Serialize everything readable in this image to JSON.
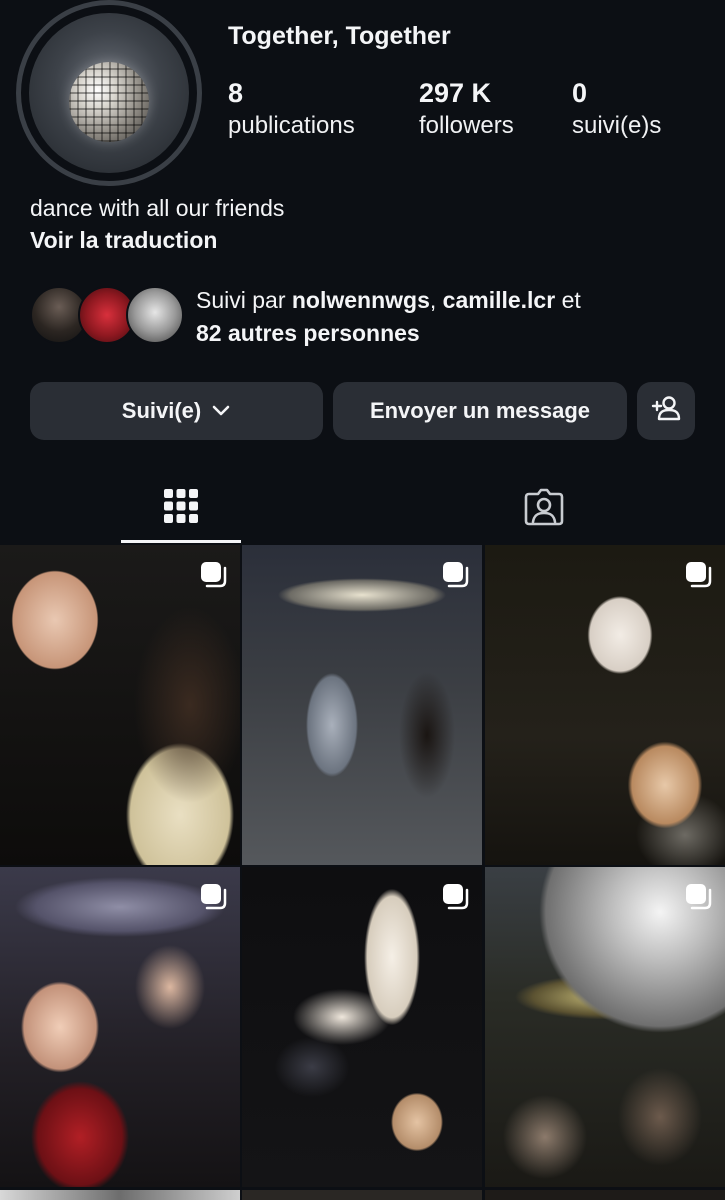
{
  "profile": {
    "display_name": "Together, Together",
    "bio": "dance with all our friends",
    "translate_link": "Voir la traduction"
  },
  "stats": {
    "posts": {
      "value": "8",
      "label": "publications"
    },
    "followers": {
      "value": "297 K",
      "label": "followers"
    },
    "following": {
      "value": "0",
      "label": "suivi(e)s"
    }
  },
  "followed_by": {
    "prefix": "Suivi par ",
    "user1": "nolwennwgs",
    "separator": ", ",
    "user2": "camille.lcr",
    "connector": " et",
    "others": "82 autres personnes"
  },
  "actions": {
    "following_label": "Suivi(e)",
    "message_label": "Envoyer un message"
  },
  "tabs": {
    "active": "grid",
    "items": [
      "grid-icon",
      "tagged-icon"
    ]
  },
  "icons": {
    "add_user": "add-person-icon",
    "multi_post": "carousel-icon",
    "chevron": "chevron-down-icon"
  },
  "colors": {
    "background": "#0c0f14",
    "button": "#2a2e35",
    "text": "#f4f5f7"
  }
}
